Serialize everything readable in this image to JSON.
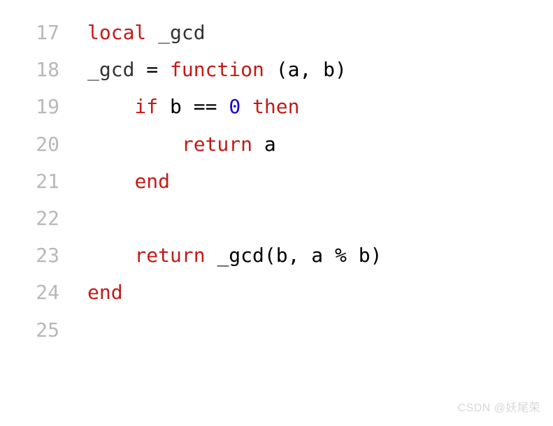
{
  "lines": [
    {
      "num": "17",
      "tokens": [
        {
          "cls": "kw",
          "t": "local"
        },
        {
          "cls": "",
          "t": " "
        },
        {
          "cls": "id",
          "t": "_gcd"
        }
      ]
    },
    {
      "num": "18",
      "tokens": [
        {
          "cls": "id",
          "t": "_gcd"
        },
        {
          "cls": "",
          "t": " = "
        },
        {
          "cls": "kw",
          "t": "function"
        },
        {
          "cls": "",
          "t": " (a, b)"
        }
      ]
    },
    {
      "num": "19",
      "tokens": [
        {
          "cls": "",
          "t": "    "
        },
        {
          "cls": "kw",
          "t": "if"
        },
        {
          "cls": "",
          "t": " b == "
        },
        {
          "cls": "num",
          "t": "0"
        },
        {
          "cls": "",
          "t": " "
        },
        {
          "cls": "kw",
          "t": "then"
        }
      ]
    },
    {
      "num": "20",
      "tokens": [
        {
          "cls": "",
          "t": "        "
        },
        {
          "cls": "kw",
          "t": "return"
        },
        {
          "cls": "",
          "t": " a"
        }
      ]
    },
    {
      "num": "21",
      "tokens": [
        {
          "cls": "",
          "t": "    "
        },
        {
          "cls": "kw",
          "t": "end"
        }
      ]
    },
    {
      "num": "22",
      "tokens": [
        {
          "cls": "",
          "t": ""
        }
      ]
    },
    {
      "num": "23",
      "tokens": [
        {
          "cls": "",
          "t": "    "
        },
        {
          "cls": "kw",
          "t": "return"
        },
        {
          "cls": "",
          "t": " _gcd(b, a % b)"
        }
      ]
    },
    {
      "num": "24",
      "tokens": [
        {
          "cls": "kw",
          "t": "end"
        }
      ]
    },
    {
      "num": "25",
      "tokens": [
        {
          "cls": "",
          "t": ""
        }
      ]
    }
  ],
  "watermark": "CSDN @妖尾荣"
}
